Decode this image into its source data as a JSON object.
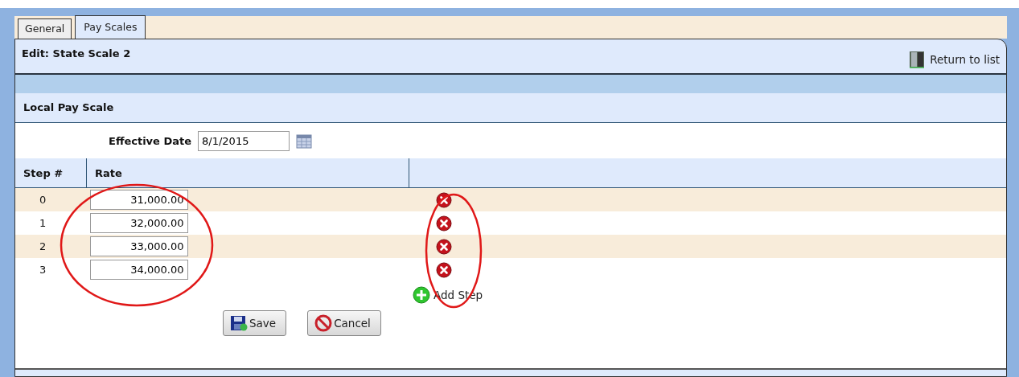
{
  "tabs": [
    {
      "label": "General",
      "selected": false
    },
    {
      "label": "Pay Scales",
      "selected": true
    }
  ],
  "header": {
    "title": "Edit: State Scale 2",
    "return_link": "Return to list"
  },
  "section": {
    "title": "Local Pay Scale"
  },
  "effective_date": {
    "label": "Effective Date",
    "value": "8/1/2015"
  },
  "table": {
    "columns": [
      "Step #",
      "Rate"
    ],
    "rows": [
      {
        "step": "0",
        "rate": "31,000.00"
      },
      {
        "step": "1",
        "rate": "32,000.00"
      },
      {
        "step": "2",
        "rate": "33,000.00"
      },
      {
        "step": "3",
        "rate": "34,000.00"
      }
    ]
  },
  "add_step": "Add Step",
  "buttons": [
    {
      "kind": "save",
      "label": "Save"
    },
    {
      "kind": "cancel",
      "label": "Cancel"
    }
  ]
}
